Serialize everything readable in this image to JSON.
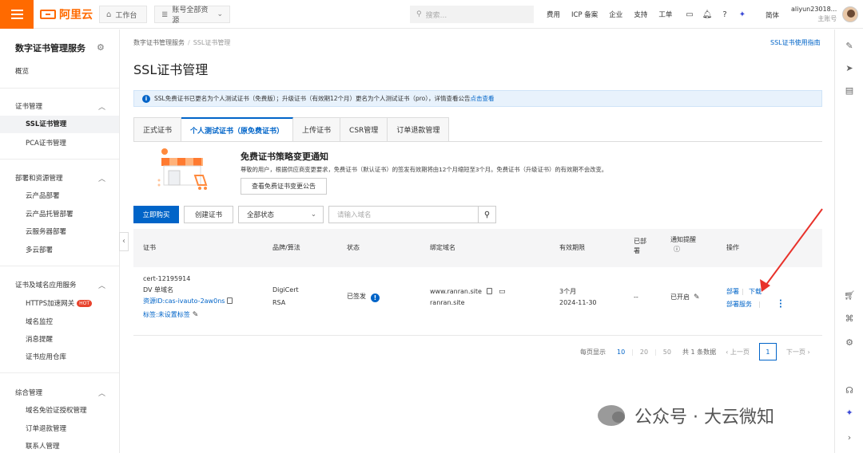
{
  "topbar": {
    "brand": "阿里云",
    "workbench": "工作台",
    "resources": "账号全部资源",
    "search_placeholder": "搜索...",
    "links": [
      "费用",
      "ICP 备案",
      "企业",
      "支持",
      "工单"
    ],
    "lang": "简体",
    "user_name": "aliyun23018...",
    "user_role": "主账号"
  },
  "sidebar": {
    "title": "数字证书管理服务",
    "overview": "概览",
    "groups": [
      {
        "label": "证书管理",
        "items": [
          "SSL证书管理",
          "PCA证书管理"
        ]
      },
      {
        "label": "部署和资源管理",
        "items": [
          "云产品部署",
          "云产品托管部署",
          "云服务器部署",
          "多云部署"
        ]
      },
      {
        "label": "证书及域名应用服务",
        "items": [
          "HTTPS加速网关",
          "域名监控",
          "消息提醒",
          "证书应用仓库"
        ]
      },
      {
        "label": "综合管理",
        "items": [
          "域名免验证授权管理",
          "订单退款管理",
          "联系人管理"
        ]
      }
    ],
    "hot_badge": "HOT"
  },
  "main": {
    "breadcrumb": [
      "数字证书管理服务",
      "SSL证书管理"
    ],
    "guide_link": "SSL证书使用指南",
    "title": "SSL证书管理",
    "notice_text": "SSL免费证书已更名为个人测试证书（免费版）；升级证书（有效期12个月）更名为个人测试证书（pro），详情查看公告",
    "notice_link": "点击查看",
    "tabs": [
      "正式证书",
      "个人测试证书（原免费证书）",
      "上传证书",
      "CSR管理",
      "订单退款管理"
    ],
    "promo": {
      "title": "免费证书策略变更通知",
      "text": "尊敬的用户，根据供应商变更要求，免费证书（默认证书）的签发有效期将由12个月缩短至3个月。免费证书（升级证书）的有效期不会改变。",
      "button": "查看免费证书变更公告"
    },
    "toolbar": {
      "buy": "立即购买",
      "create": "创建证书",
      "status_select": "全部状态",
      "domain_placeholder": "请输入域名"
    },
    "table": {
      "headers": {
        "cert": "证书",
        "brand": "品牌/算法",
        "status": "状态",
        "domain": "绑定域名",
        "validity": "有效期限",
        "deployed_1": "已部",
        "deployed_2": "署",
        "notify_1": "通知提醒",
        "ops": "操作"
      },
      "row": {
        "cert_name": "cert-12195914",
        "cert_type": "DV 单域名",
        "resource_id": "资源ID:cas-ivauto-2aw0ns",
        "tag": "标签:未设置标签",
        "brand": "DigiCert",
        "algo": "RSA",
        "status": "已签发",
        "domain_1": "www.ranran.site",
        "domain_2": "ranran.site",
        "validity": "3个月",
        "expire": "2024-11-30",
        "deployed": "--",
        "notify": "已开启",
        "op_deploy": "部署",
        "op_download": "下载",
        "op_service": "部署服务"
      }
    },
    "pager": {
      "per_page_label": "每页显示",
      "sizes": [
        "10",
        "20",
        "50"
      ],
      "total": "共 1 条数据",
      "prev": "上一页",
      "page": "1",
      "next": "下一页"
    }
  },
  "watermark": "公众号 · 大云微知",
  "colors": {
    "brand": "#ff6a00",
    "primary": "#0064c8",
    "arrow": "#e8322b"
  }
}
